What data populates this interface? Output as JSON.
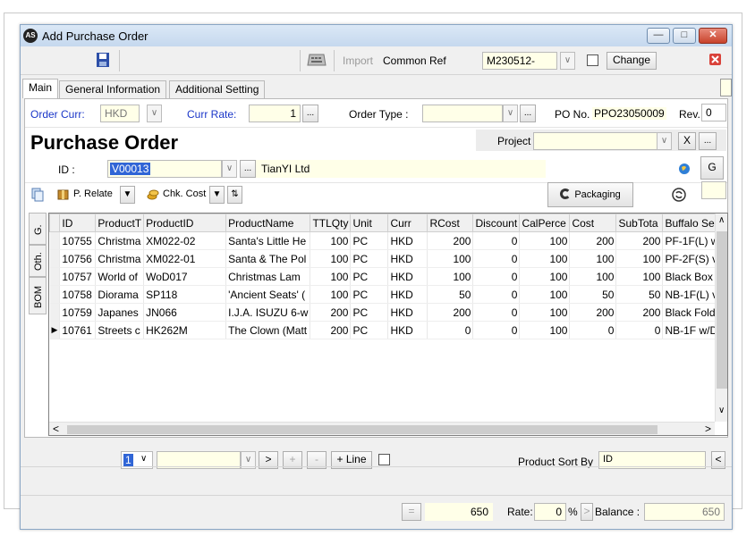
{
  "window": {
    "title": "Add Purchase Order",
    "app_icon_text": "⚙"
  },
  "toolbar": {
    "import_label": "Import",
    "common_ref_label": "Common Ref",
    "common_ref_value": "M230512-",
    "change_label": "Change"
  },
  "tabs": [
    "Main",
    "General Information",
    "Additional Setting"
  ],
  "form": {
    "order_curr_label": "Order Curr:",
    "order_curr_value": "HKD",
    "curr_rate_label": "Curr Rate:",
    "curr_rate_value": "1",
    "order_type_label": "Order Type :",
    "order_type_value": "",
    "po_no_label": "PO No.",
    "po_no_value": "PPO23050009",
    "rev_label": "Rev.",
    "rev_value": "0",
    "heading": "Purchase Order",
    "project_label": "Project",
    "project_value": "",
    "id_label": "ID :",
    "id_value": "V00013",
    "supplier_name": "TianYI  Ltd",
    "ellipsis": "...",
    "g_button": "G",
    "x_button": "X"
  },
  "actions": {
    "p_relate": "P. Relate",
    "chk_cost": "Chk. Cost",
    "packaging": "Packaging"
  },
  "side_tabs": [
    "G.",
    "Oth.",
    "BOM"
  ],
  "grid": {
    "columns": [
      "ID",
      "ProductT",
      "ProductID",
      "ProductName",
      "TTLQty",
      "Unit",
      "Curr",
      "RCost",
      "Discount",
      "CalPerce",
      "Cost",
      "SubTota",
      "Buffalo Se"
    ],
    "rows": [
      [
        "10755",
        "Christma",
        "XM022-02",
        "Santa's Little He",
        "100",
        "PC",
        "HKD",
        "200",
        "0",
        "100",
        "200",
        "200",
        "PF-1F(L) w"
      ],
      [
        "10756",
        "Christma",
        "XM022-01",
        "Santa & The Pol",
        "100",
        "PC",
        "HKD",
        "100",
        "0",
        "100",
        "100",
        "100",
        "PF-2F(S) v"
      ],
      [
        "10757",
        "World of",
        "WoD017",
        "Christmas Lam",
        "100",
        "PC",
        "HKD",
        "100",
        "0",
        "100",
        "100",
        "100",
        "Black Box"
      ],
      [
        "10758",
        "Diorama",
        "SP118",
        "'Ancient Seats' (",
        "100",
        "PC",
        "HKD",
        "50",
        "0",
        "100",
        "50",
        "50",
        "NB-1F(L) v"
      ],
      [
        "10759",
        "Japanes",
        "JN066",
        "I.J.A. ISUZU 6-w",
        "200",
        "PC",
        "HKD",
        "200",
        "0",
        "100",
        "200",
        "200",
        "Black Fold"
      ],
      [
        "10761",
        "Streets c",
        "HK262M",
        "The Clown (Matt",
        "200",
        "PC",
        "HKD",
        "0",
        "0",
        "100",
        "0",
        "0",
        "NB-1F w/D"
      ]
    ],
    "current_row_marker": "▶"
  },
  "bottom_bar": {
    "page_value": "1",
    "next_label": ">",
    "plus_label": "+",
    "minus_label": "-",
    "add_line_label": "+ Line",
    "product_sort_label": "Product Sort By",
    "product_sort_value": "ID",
    "collapse_label": "<"
  },
  "footer": {
    "equals_label": "=",
    "total_value": "650",
    "rate_label": "Rate:",
    "rate_value": "0",
    "percent_label": "%",
    "arrow_label": ">",
    "balance_label": "Balance :",
    "balance_value": "650"
  },
  "colors": {
    "accent_blue": "#1a36c8",
    "input_yellow": "#ffffe8",
    "selection_blue": "#3065d6"
  }
}
